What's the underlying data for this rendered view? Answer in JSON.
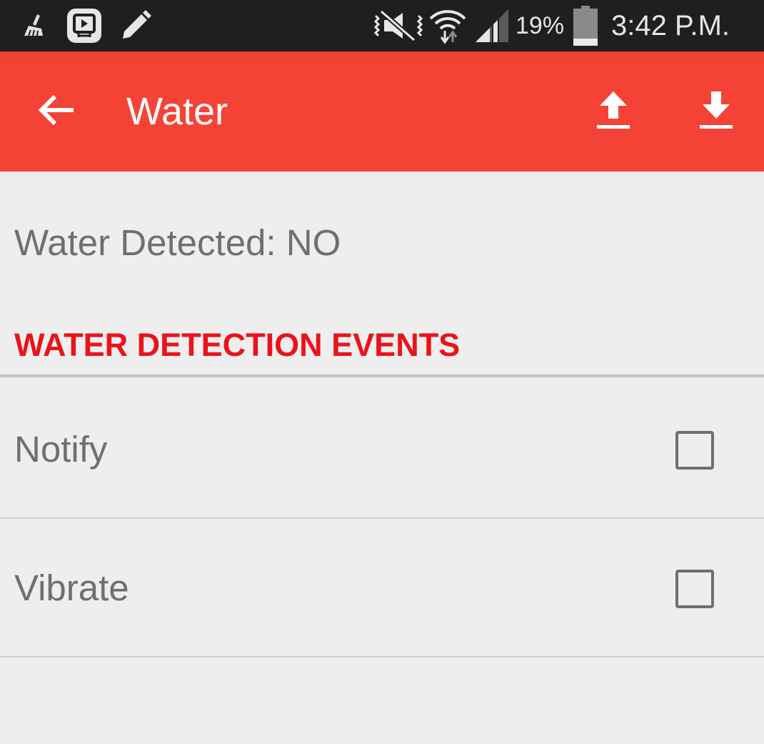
{
  "status_bar": {
    "battery_percent": "19%",
    "time": "3:42 P.M.",
    "icons": [
      "cleaner-broom-icon",
      "app-notification-icon",
      "pencil-icon",
      "vibrate-mode-icon",
      "wifi-icon",
      "cellular-signal-icon",
      "battery-icon"
    ]
  },
  "app_bar": {
    "title": "Water",
    "back_icon": "back-arrow-icon",
    "actions": [
      "upload-icon",
      "download-icon"
    ],
    "color": "#f44336"
  },
  "status": {
    "text": "Water Detected: NO"
  },
  "section": {
    "header": "WATER DETECTION EVENTS",
    "color": "#e8141a",
    "items": [
      {
        "label": "Notify",
        "checked": false
      },
      {
        "label": "Vibrate",
        "checked": false
      }
    ]
  }
}
